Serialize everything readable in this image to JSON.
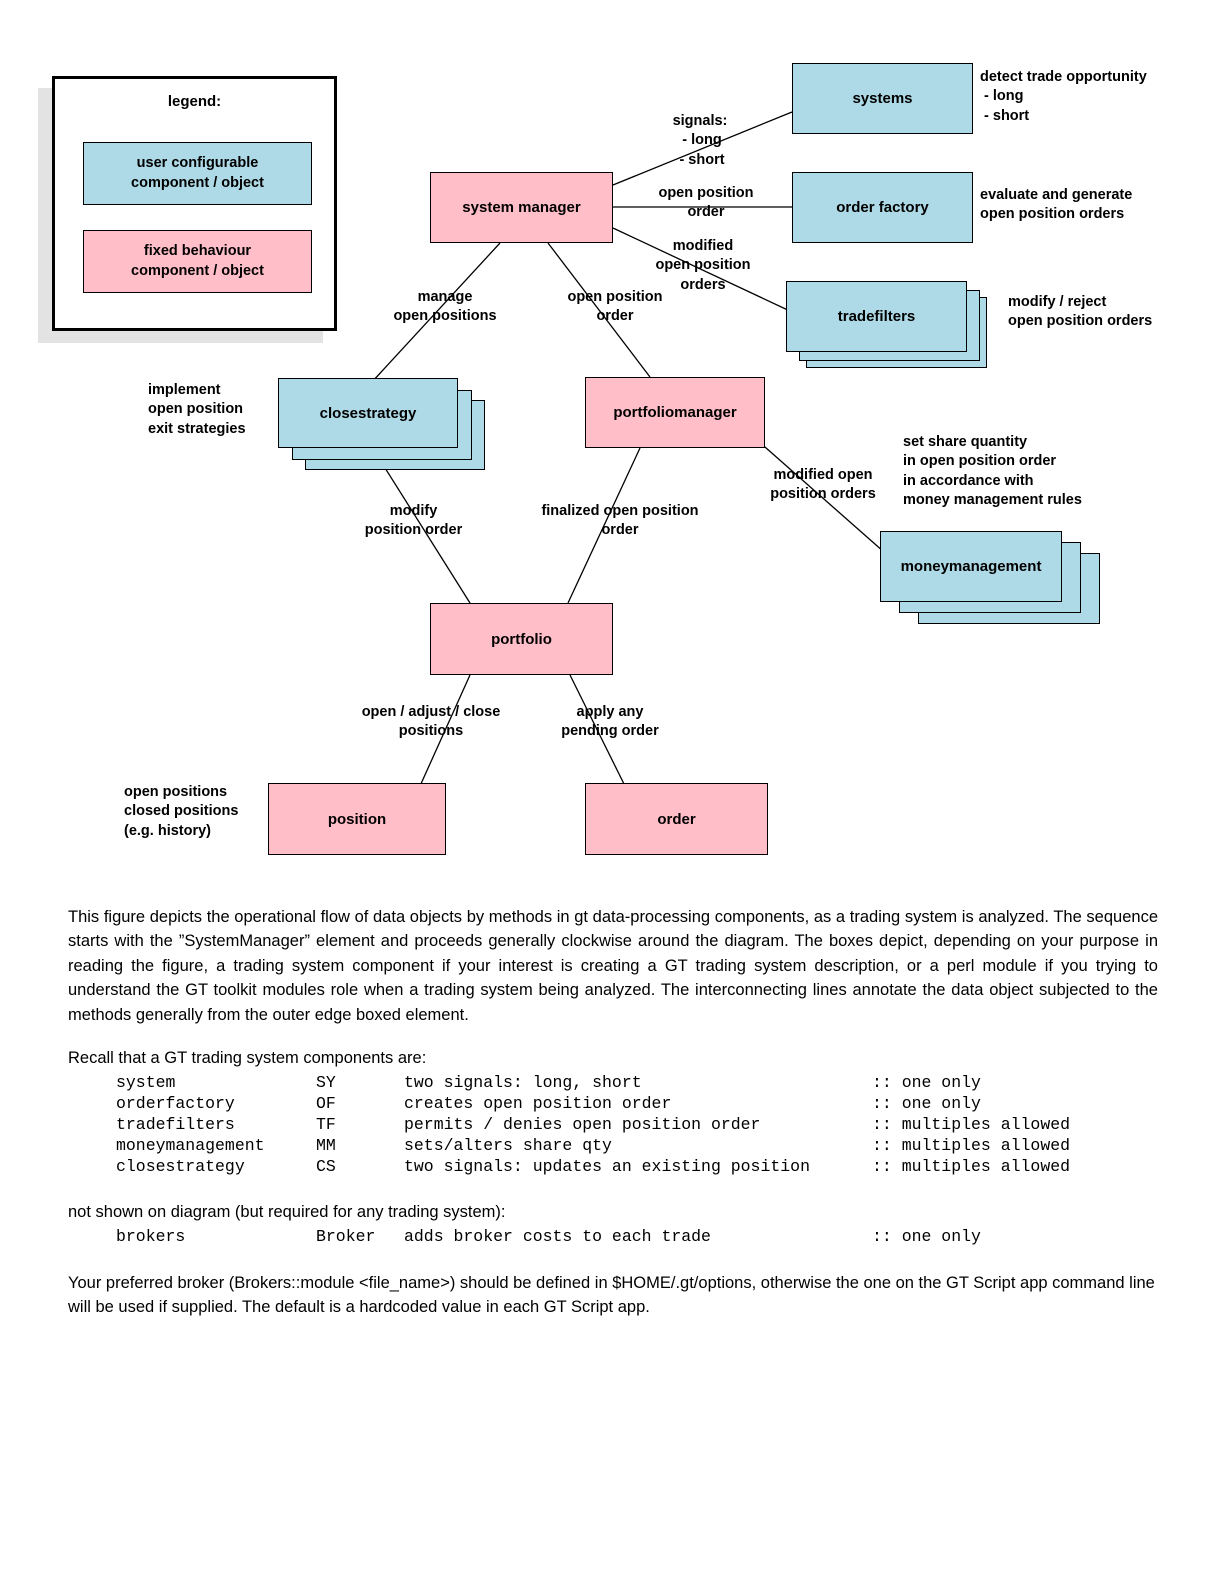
{
  "legend": {
    "title": "legend:",
    "items": [
      {
        "kind": "blue",
        "line1": "user configurable",
        "line2": "component / object",
        "color": "#addae6"
      },
      {
        "kind": "pink",
        "line1": "fixed behaviour",
        "line2": "component / object",
        "color": "#ffbec8"
      }
    ]
  },
  "nodes": {
    "system_manager": "system manager",
    "systems": "systems",
    "order_factory": "order factory",
    "tradefilters": "tradefilters",
    "closestrategy": "closestrategy",
    "portfoliomanager": "portfoliomanager",
    "moneymanagement": "moneymanagement",
    "portfolio": "portfolio",
    "position": "position",
    "order": "order"
  },
  "edge_labels": {
    "signals": "signals:\n - long\n - short",
    "open_position_order_top": "open position\norder",
    "modified_open_position_orders": "modified\nopen position\norders",
    "manage_open_positions": "manage\nopen positions",
    "open_position_order_mid": "open position\norder",
    "modify_position_order": "modify\nposition order",
    "finalized_open_position_order": "finalized open position\norder",
    "modified_open_position_orders2": "modified open\nposition orders",
    "open_adjust_close_positions": "open / adjust / close\npositions",
    "apply_any_pending_order": "apply any\npending order"
  },
  "annotations": {
    "systems_note": "detect trade opportunity\n - long\n - short",
    "order_factory_note": "evaluate and generate\nopen position orders",
    "tradefilters_note": "modify / reject\nopen position orders",
    "closestrategy_note": "implement\nopen position\nexit strategies",
    "moneymanagement_note": "set share quantity\nin open position order\nin accordance with\nmoney management rules",
    "position_note": "open positions\nclosed positions\n(e.g. history)"
  },
  "prose": {
    "paragraph1": "This figure depicts the operational flow of data objects by methods in gt data-processing components, as a trading system is analyzed.  The sequence starts with the ”SystemManager” element and proceeds generally clockwise around the diagram.  The boxes depict, depending on your purpose in reading the figure, a trading system component if your interest is creating a GT trading system description, or a perl module if you trying to understand the GT toolkit modules role when a trading system being analyzed.  The interconnecting lines annotate the data object subjected to the methods generally from the outer edge boxed element.",
    "recall_heading": "Recall that a GT trading system components are:",
    "components": [
      {
        "name": "system",
        "abbr": "SY",
        "desc": "two signals: long, short",
        "mult": ":: one only"
      },
      {
        "name": "orderfactory",
        "abbr": "OF",
        "desc": "creates open position order",
        "mult": ":: one only"
      },
      {
        "name": "tradefilters",
        "abbr": "TF",
        "desc": "permits / denies open position order",
        "mult": ":: multiples allowed"
      },
      {
        "name": "moneymanagement",
        "abbr": "MM",
        "desc": "sets/alters share qty",
        "mult": ":: multiples allowed"
      },
      {
        "name": "closestrategy",
        "abbr": "CS",
        "desc": "two signals: updates an existing position",
        "mult": ":: multiples allowed"
      }
    ],
    "not_shown_heading": "not shown on diagram (but required for any trading system):",
    "not_shown": [
      {
        "name": "brokers",
        "abbr": "Broker",
        "desc": "adds broker costs to each trade",
        "mult": ":: one only"
      }
    ],
    "paragraph2": "Your preferred broker (Brokers::module <file_name>) should be defined in $HOME/.gt/options, otherwise the one on the GT Script app command line will be used if supplied.  The default is a hardcoded value in each GT Script app."
  }
}
